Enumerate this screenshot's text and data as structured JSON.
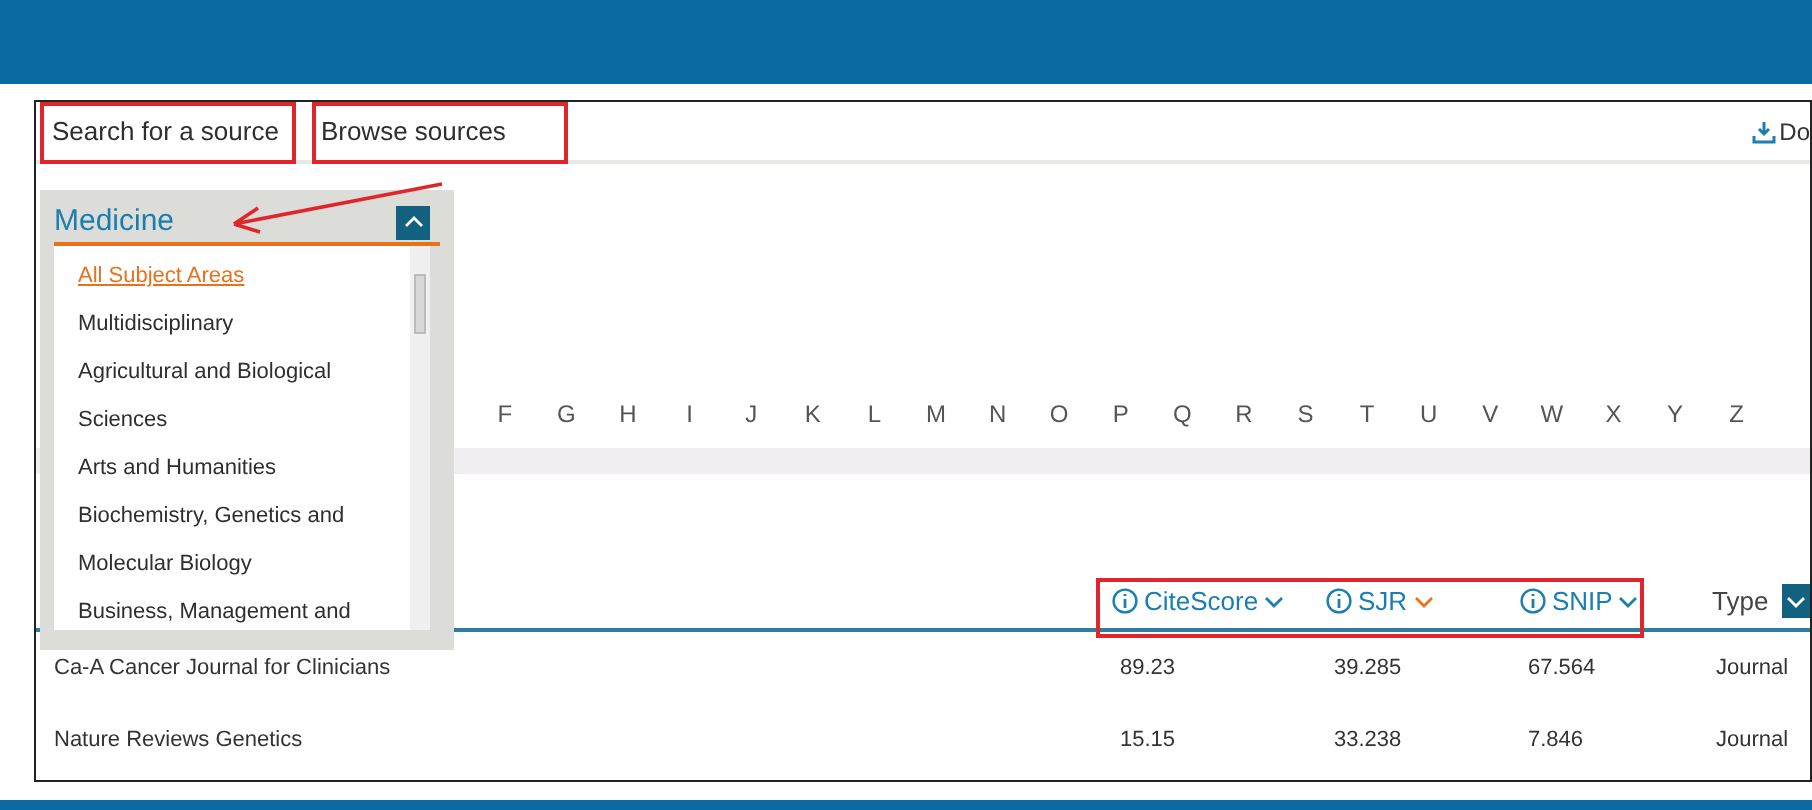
{
  "tabs": [
    {
      "label": "Search for a source",
      "selected": false
    },
    {
      "label": "Browse sources",
      "selected": false
    }
  ],
  "download": {
    "label": "Do"
  },
  "subject_dropdown": {
    "value": "Medicine",
    "expanded": true,
    "items": [
      {
        "label": "All Subject Areas",
        "selected": true
      },
      {
        "label": "Multidisciplinary",
        "selected": false
      },
      {
        "label": "Agricultural and Biological Sciences",
        "selected": false
      },
      {
        "label": "Arts and Humanities",
        "selected": false
      },
      {
        "label": "Biochemistry, Genetics and Molecular Biology",
        "selected": false
      },
      {
        "label": "Business, Management and",
        "selected": false
      }
    ]
  },
  "letters": [
    "F",
    "G",
    "H",
    "I",
    "J",
    "K",
    "L",
    "M",
    "N",
    "O",
    "P",
    "Q",
    "R",
    "S",
    "T",
    "U",
    "V",
    "W",
    "X",
    "Y",
    "Z"
  ],
  "table": {
    "columns": [
      {
        "label": "CiteScore",
        "sorted": false
      },
      {
        "label": "SJR",
        "sorted": true
      },
      {
        "label": "SNIP",
        "sorted": false
      },
      {
        "label": "Type",
        "sorted": false
      }
    ],
    "rows": [
      {
        "title": "Ca-A Cancer Journal for Clinicians",
        "citescore": "89.23",
        "sjr": "39.285",
        "snip": "67.564",
        "type": "Journal"
      },
      {
        "title": "Nature Reviews Genetics",
        "citescore": "15.15",
        "sjr": "33.238",
        "snip": "7.846",
        "type": "Journal"
      }
    ]
  }
}
